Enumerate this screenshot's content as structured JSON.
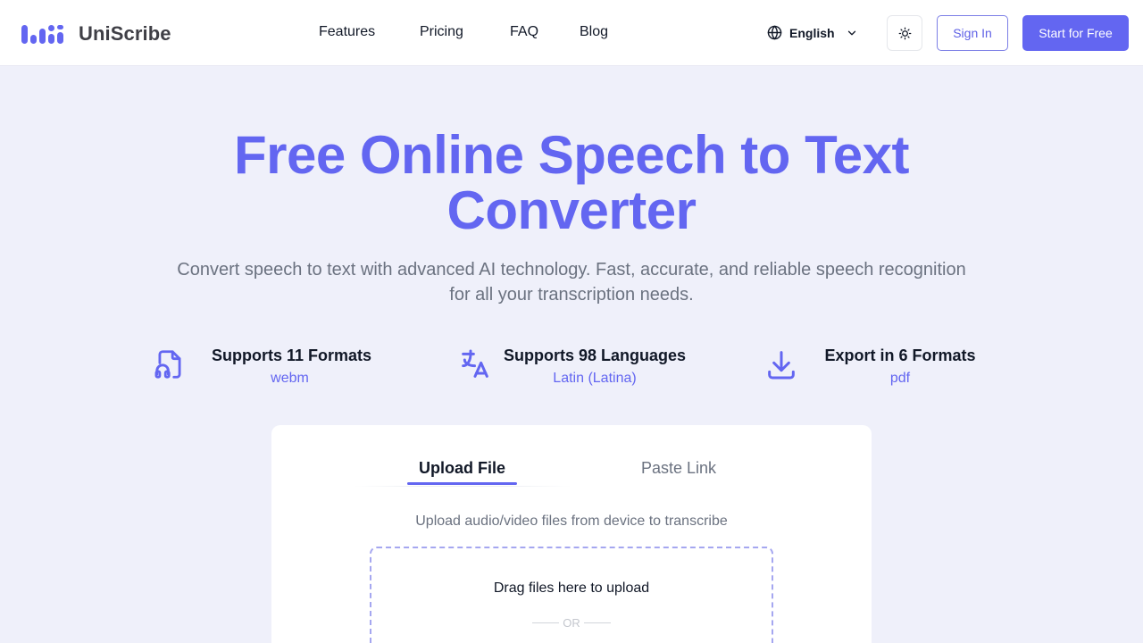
{
  "header": {
    "brand": "UniScribe",
    "nav": [
      "Features",
      "Pricing",
      "FAQ",
      "Blog"
    ],
    "language": "English",
    "sign_in": "Sign In",
    "start": "Start for Free"
  },
  "hero": {
    "title": "Free Online Speech to Text Converter",
    "subtitle": "Convert speech to text with advanced AI technology. Fast, accurate, and reliable speech recognition for all your transcription needs."
  },
  "features": [
    {
      "title": "Supports 11 Formats",
      "value": "webm",
      "icon": "audio-file-icon"
    },
    {
      "title": "Supports 98 Languages",
      "value": "Latin (Latina)",
      "icon": "translate-icon"
    },
    {
      "title": "Export in 6 Formats",
      "value": "pdf",
      "icon": "download-icon"
    }
  ],
  "upload": {
    "tabs": [
      "Upload File",
      "Paste Link"
    ],
    "active_tab": "Upload File",
    "description": "Upload audio/video files from device to transcribe",
    "drop_text": "Drag files here to upload",
    "or_text": "OR"
  },
  "colors": {
    "accent": "#6366f1",
    "background": "#eff0fa"
  }
}
